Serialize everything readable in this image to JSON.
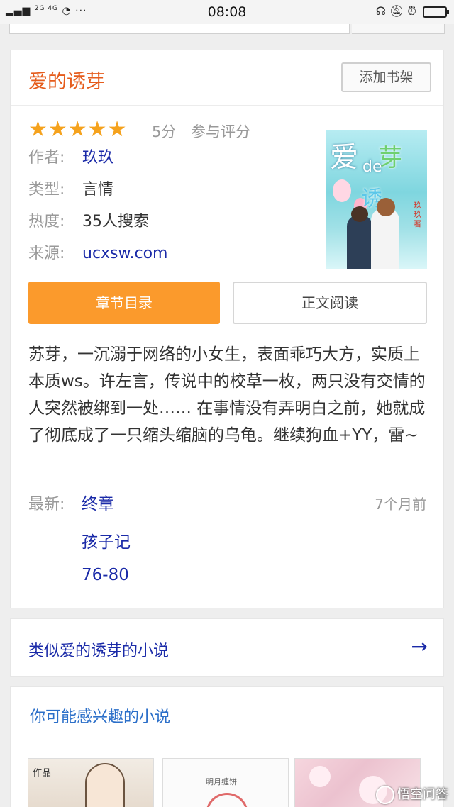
{
  "status_bar": {
    "left": "2G 4G",
    "time": "08:08"
  },
  "book": {
    "title": "爱的诱芽",
    "add_shelf_label": "添加书架",
    "stars": "★★★★★",
    "score": "5分",
    "rate_label": "参与评分",
    "meta": [
      {
        "label": "作者:",
        "value": "玖玖"
      },
      {
        "label": "类型:",
        "value": "言情"
      },
      {
        "label": "热度:",
        "value": "35人搜索"
      },
      {
        "label": "来源:",
        "value": "ucxsw.com"
      }
    ],
    "cover": {
      "title_char1": "爱",
      "title_de": "de",
      "title_char2": "芽",
      "title_char3": "诱",
      "author": "玖玖著"
    },
    "toc_button": "章节目录",
    "read_button": "正文阅读",
    "description": "苏芽，一沉溺于网络的小女生，表面乖巧大方，实质上本质ws。许左言，传说中的校草一枚，两只没有交情的人突然被绑到一处…… 在事情没有弄明白之前，她就成了彻底成了一只缩头缩脑的乌龟。继续狗血+YY，雷~",
    "latest_label": "最新:",
    "latest_time": "7个月前",
    "chapters": [
      "终章",
      "孩子记",
      "76-80"
    ]
  },
  "similar": {
    "label": "类似爱的诱芽的小说",
    "arrow": "→"
  },
  "interest": {
    "title": "你可能感兴趣的小说",
    "thumb1_text": "作品",
    "thumb2_text": "明月缠饼"
  },
  "watermark": "悟空问答",
  "colors": {
    "title_orange": "#e55c1c",
    "star": "#f5a21d",
    "primary_button": "#fb9a2c",
    "link_blue": "#1a2aa8"
  }
}
